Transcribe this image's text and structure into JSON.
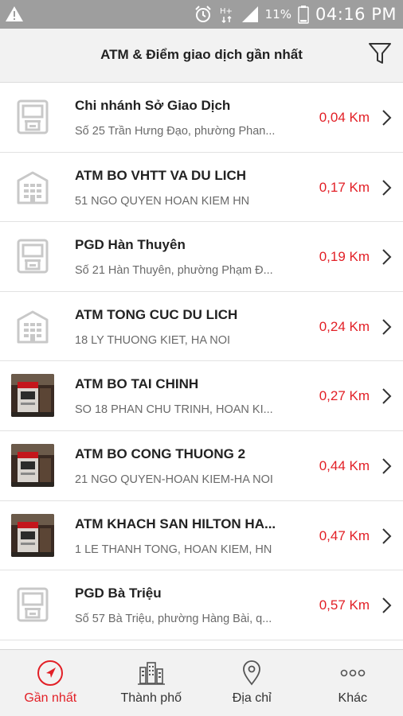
{
  "status_bar": {
    "battery_percent": "11%",
    "time": "04:16 PM",
    "icons": [
      "warning-icon",
      "alarm-icon",
      "network-h-plus-icon",
      "signal-icon",
      "battery-icon"
    ]
  },
  "header": {
    "title": "ATM & Điểm giao dịch gần nhất",
    "filter_icon": "filter-funnel-icon"
  },
  "locations": [
    {
      "name": "Chi nhánh Sở Giao Dịch",
      "address": "Số 25 Trần Hưng Đạo, phường Phan...",
      "distance": "0,04 Km",
      "thumbnail": "atm-machine-icon"
    },
    {
      "name": "ATM BO VHTT VA DU LICH",
      "address": "51 NGO QUYEN HOAN KIEM HN",
      "distance": "0,17 Km",
      "thumbnail": "building-icon"
    },
    {
      "name": " PGD Hàn Thuyên",
      "address": "Số 21 Hàn Thuyên, phường Phạm Đ...",
      "distance": "0,19 Km",
      "thumbnail": "atm-machine-icon"
    },
    {
      "name": "ATM TONG CUC DU LICH",
      "address": "18 LY THUONG KIET,  HA NOI",
      "distance": "0,24 Km",
      "thumbnail": "building-icon"
    },
    {
      "name": "ATM BO TAI CHINH",
      "address": "SO 18 PHAN CHU TRINH, HOAN KI...",
      "distance": "0,27 Km",
      "thumbnail": "atm-photo"
    },
    {
      "name": "ATM BO CONG THUONG 2",
      "address": "21 NGO QUYEN-HOAN KIEM-HA NOI",
      "distance": "0,44 Km",
      "thumbnail": "atm-photo"
    },
    {
      "name": "ATM KHACH SAN HILTON HA...",
      "address": "1 LE THANH TONG, HOAN KIEM, HN",
      "distance": "0,47 Km",
      "thumbnail": "atm-photo"
    },
    {
      "name": " PGD Bà Triệu",
      "address": "Số 57 Bà Triệu, phường Hàng Bài, q...",
      "distance": "0,57 Km",
      "thumbnail": "atm-machine-icon"
    }
  ],
  "bottom_nav": [
    {
      "label": "Gần nhất",
      "icon": "navigation-arrow-icon",
      "active": true
    },
    {
      "label": "Thành phố",
      "icon": "city-icon",
      "active": false
    },
    {
      "label": "Địa chỉ",
      "icon": "location-pin-icon",
      "active": false
    },
    {
      "label": "Khác",
      "icon": "more-dots-icon",
      "active": false
    }
  ],
  "colors": {
    "accent": "#e21f26",
    "status_bar": "#9e9e9e",
    "icon_gray": "#c8c8c8"
  }
}
